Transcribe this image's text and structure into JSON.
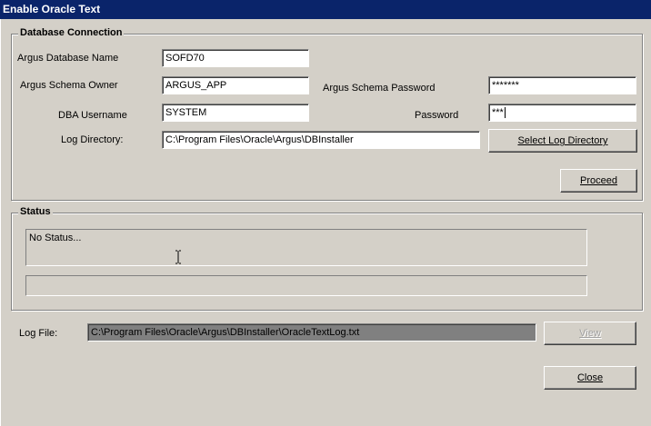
{
  "window": {
    "title": "Enable Oracle Text"
  },
  "db_connection": {
    "legend": "Database Connection",
    "db_name_label": "Argus Database Name",
    "db_name_value": "SOFD70",
    "schema_owner_label": "Argus Schema Owner",
    "schema_owner_value": "ARGUS_APP",
    "schema_password_label": "Argus Schema Password",
    "schema_password_value": "*******",
    "dba_user_label": "DBA Username",
    "dba_user_value": "SYSTEM",
    "password_label": "Password",
    "password_value": "***",
    "log_dir_label": "Log Directory:",
    "log_dir_value": "C:\\Program Files\\Oracle\\Argus\\DBInstaller",
    "select_log_dir_button": "Select Log Directory",
    "proceed_button": "Proceed"
  },
  "status": {
    "legend": "Status",
    "text": "No Status...",
    "progress_text": ""
  },
  "log_file": {
    "label": "Log File:",
    "value": "C:\\Program Files\\Oracle\\Argus\\DBInstaller\\OracleTextLog.txt",
    "view_button": "View",
    "close_button": "Close"
  }
}
